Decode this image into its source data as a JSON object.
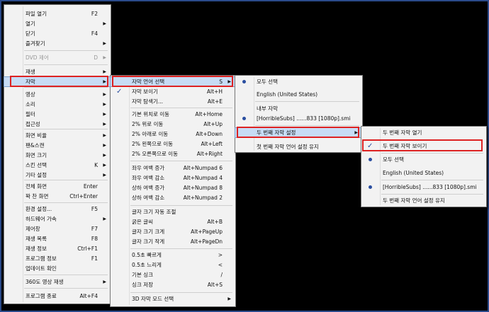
{
  "menu1": {
    "items": [
      {
        "label": "파일 열기",
        "shortcut": "F2"
      },
      {
        "label": "열기",
        "arrow": true
      },
      {
        "label": "닫기",
        "shortcut": "F4"
      },
      {
        "label": "즐겨찾기",
        "arrow": true
      },
      {
        "label": "DVD 제어",
        "shortcut": "D",
        "arrow": true,
        "disabled": true
      },
      {
        "label": "재생",
        "arrow": true
      },
      {
        "label": "자막",
        "arrow": true,
        "highlight": true
      },
      {
        "label": "영상",
        "arrow": true
      },
      {
        "label": "소리",
        "arrow": true
      },
      {
        "label": "필터",
        "arrow": true
      },
      {
        "label": "접근성",
        "arrow": true
      },
      {
        "label": "화면 비율",
        "arrow": true
      },
      {
        "label": "팬&스캔",
        "arrow": true
      },
      {
        "label": "화면 크기",
        "arrow": true
      },
      {
        "label": "스킨 선택",
        "shortcut": "K",
        "arrow": true
      },
      {
        "label": "기타 설정",
        "arrow": true
      },
      {
        "label": "전체 화면",
        "shortcut": "Enter"
      },
      {
        "label": "꽉 찬 화면",
        "shortcut": "Ctrl+Enter"
      },
      {
        "label": "환경 설정...",
        "shortcut": "F5"
      },
      {
        "label": "하드웨어 가속",
        "arrow": true
      },
      {
        "label": "제어창",
        "shortcut": "F7"
      },
      {
        "label": "재생 목록",
        "shortcut": "F8"
      },
      {
        "label": "재생 정보",
        "shortcut": "Ctrl+F1"
      },
      {
        "label": "프로그램 정보",
        "shortcut": "F1"
      },
      {
        "label": "업데이트 확인"
      },
      {
        "label": "360도 영상 재생",
        "arrow": true
      },
      {
        "label": "프로그램 종료",
        "shortcut": "Alt+F4"
      }
    ]
  },
  "menu2": {
    "items": [
      {
        "label": "자막 언어 선택",
        "shortcut": "S",
        "arrow": true,
        "highlight": true
      },
      {
        "label": "자막 보이기",
        "shortcut": "Alt+H",
        "checked": true
      },
      {
        "label": "자막 탐색기...",
        "shortcut": "Alt+E"
      },
      {
        "label": "기본 위치로 이동",
        "shortcut": "Alt+Home"
      },
      {
        "label": "2% 위로 이동",
        "shortcut": "Alt+Up"
      },
      {
        "label": "2% 아래로 이동",
        "shortcut": "Alt+Down"
      },
      {
        "label": "2% 왼쪽으로 이동",
        "shortcut": "Alt+Left"
      },
      {
        "label": "2% 오른쪽으로 이동",
        "shortcut": "Alt+Right"
      },
      {
        "label": "좌우 여백 증가",
        "shortcut": "Alt+Numpad 6"
      },
      {
        "label": "좌우 여백 감소",
        "shortcut": "Alt+Numpad 4"
      },
      {
        "label": "상하 여백 증가",
        "shortcut": "Alt+Numpad 8"
      },
      {
        "label": "상하 여백 감소",
        "shortcut": "Alt+Numpad 2"
      },
      {
        "label": "글자 크기 자동 조절"
      },
      {
        "label": "굵은 글씨",
        "shortcut": "Alt+B"
      },
      {
        "label": "글자 크기 크게",
        "shortcut": "Alt+PageUp"
      },
      {
        "label": "글자 크기 작게",
        "shortcut": "Alt+PageDn"
      },
      {
        "label": "0.5초 빠르게",
        "shortcut": ">"
      },
      {
        "label": "0.5초 느리게",
        "shortcut": "<"
      },
      {
        "label": "기본 싱크",
        "shortcut": "/"
      },
      {
        "label": "싱크 저장",
        "shortcut": "Alt+S"
      },
      {
        "label": "3D 자막 모드 선택",
        "arrow": true
      }
    ]
  },
  "menu3": {
    "items": [
      {
        "label": "모두 선택",
        "bullet": true
      },
      {
        "label": "English (United States)"
      },
      {
        "label": "내부 자막"
      },
      {
        "label": "[HorribleSubs] ......833 [1080p].smi",
        "bullet": true
      },
      {
        "label": "두 번째 자막 설정",
        "arrow": true,
        "highlight": true
      },
      {
        "label": "첫 번째 자막 언어 설정 유지"
      }
    ]
  },
  "menu4": {
    "items": [
      {
        "label": "두 번째 자막 열기"
      },
      {
        "label": "두 번째 자막 보이기",
        "checked": true
      },
      {
        "label": "모두 선택",
        "bullet": true
      },
      {
        "label": "English (United States)"
      },
      {
        "label": "[HorribleSubs] ......833 [1080p].smi",
        "bullet": true
      },
      {
        "label": "두 번째 자막 언어 설정 유지"
      }
    ]
  }
}
